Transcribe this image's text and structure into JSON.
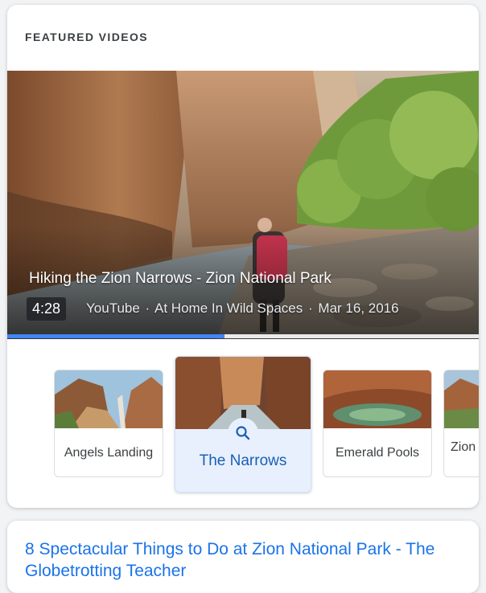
{
  "section": {
    "title": "FEATURED VIDEOS"
  },
  "video": {
    "title": "Hiking the Zion Narrows - Zion National Park",
    "duration": "4:28",
    "source": "YouTube",
    "channel": "At Home In Wild Spaces",
    "date": "Mar 16, 2016",
    "separator": "·",
    "progress_fraction": 0.46
  },
  "chips": [
    {
      "label": "Angels Landing",
      "active": false
    },
    {
      "label": "The Narrows",
      "active": true
    },
    {
      "label": "Emerald Pools",
      "active": false
    },
    {
      "label": "Zion C",
      "active": false
    }
  ],
  "result": {
    "title": "8 Spectacular Things to Do at Zion National Park - The Globetrotting Teacher"
  },
  "colors": {
    "accent": "#4285f4",
    "link": "#1a73e8",
    "active_chip_bg": "#e8f0fe"
  },
  "icons": {
    "chip_search": "search-icon"
  }
}
